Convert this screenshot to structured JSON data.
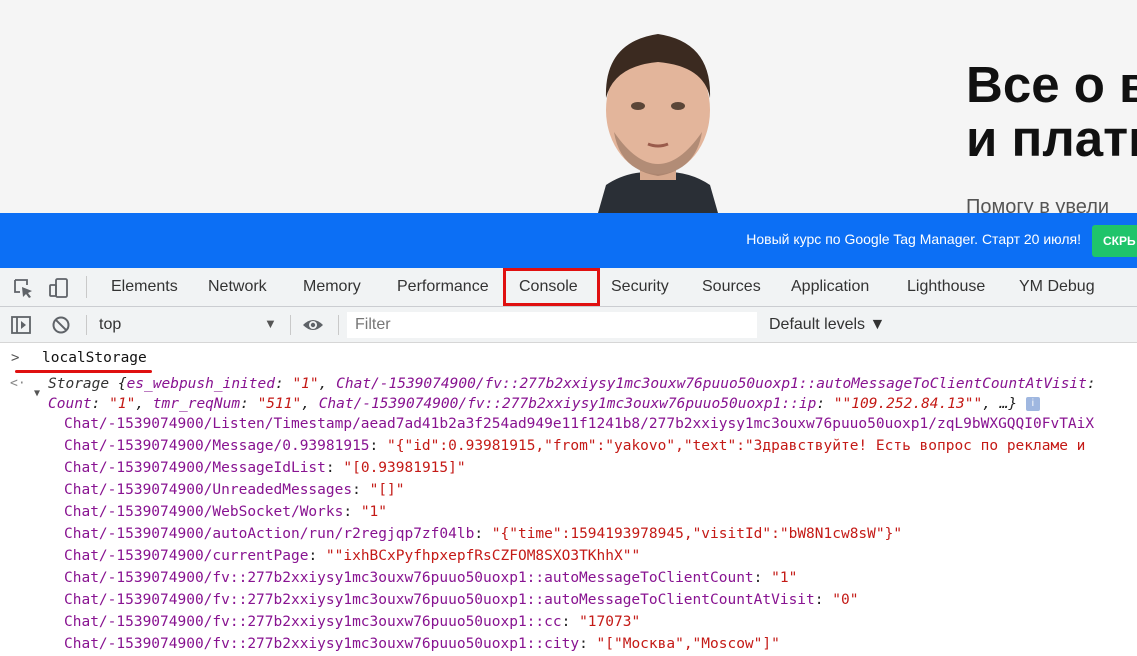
{
  "site": {
    "headline_line1": "Все о в",
    "headline_line2": "и платн",
    "subline": "Помогу в увели"
  },
  "promo": {
    "text": "Новый курс по Google Tag Manager. Старт 20 июля!",
    "button": "СКРЬ"
  },
  "devtools": {
    "tabs": [
      "Elements",
      "Network",
      "Memory",
      "Performance",
      "Console",
      "Security",
      "Sources",
      "Application",
      "Lighthouse",
      "YM Debug"
    ],
    "active_tab": "Console",
    "context": "top",
    "filter_placeholder": "Filter",
    "levels": "Default levels ▼"
  },
  "console": {
    "input": "localStorage",
    "summary_line1": {
      "type": "Storage",
      "parts": [
        {
          "k": "es_webpush_inited",
          "v": "\"1\""
        },
        {
          "k": "Chat/-1539074900/fv::277b2xxiysy1mc3ouxw76puuo50uoxp1::autoMessageToClientCountAtVisit",
          "v": ""
        }
      ]
    },
    "summary_line2": {
      "start": "Count",
      "count_val": "\"1\"",
      "tmr_key": "tmr_reqNum",
      "tmr_val": "\"511\"",
      "ip_key": "Chat/-1539074900/fv::277b2xxiysy1mc3ouxw76puuo50uoxp1::ip",
      "ip_val": "\"\"109.252.84.13\"\"",
      "tail": ", …}"
    },
    "entries": [
      {
        "key": "Chat/-1539074900/Listen/Timestamp/aead7ad41b2a3f254ad949e11f1241b8/277b2xxiysy1mc3ouxw76puuo50uoxp1/zqL9bWXGQQI0FvTAiX",
        "value": ""
      },
      {
        "key": "Chat/-1539074900/Message/0.93981915",
        "value": "\"{\"id\":0.93981915,\"from\":\"yakovo\",\"text\":\"Здравствуйте! Есть вопрос по рекламе и"
      },
      {
        "key": "Chat/-1539074900/MessageIdList",
        "value": "\"[0.93981915]\""
      },
      {
        "key": "Chat/-1539074900/UnreadedMessages",
        "value": "\"[]\""
      },
      {
        "key": "Chat/-1539074900/WebSocket/Works",
        "value": "\"1\""
      },
      {
        "key": "Chat/-1539074900/autoAction/run/r2regjqp7zf04lb",
        "value": "\"{\"time\":1594193978945,\"visitId\":\"bW8N1cw8sW\"}\""
      },
      {
        "key": "Chat/-1539074900/currentPage",
        "value": "\"\"ixhBCxPyfhpxepfRsCZFOM8SXO3TKhhX\"\""
      },
      {
        "key": "Chat/-1539074900/fv::277b2xxiysy1mc3ouxw76puuo50uoxp1::autoMessageToClientCount",
        "value": "\"1\""
      },
      {
        "key": "Chat/-1539074900/fv::277b2xxiysy1mc3ouxw76puuo50uoxp1::autoMessageToClientCountAtVisit",
        "value": "\"0\""
      },
      {
        "key": "Chat/-1539074900/fv::277b2xxiysy1mc3ouxw76puuo50uoxp1::cc",
        "value": "\"17073\""
      },
      {
        "key": "Chat/-1539074900/fv::277b2xxiysy1mc3ouxw76puuo50uoxp1::city",
        "value": "\"[\"Москва\",\"Moscow\"]\""
      }
    ]
  },
  "colors": {
    "promo_blue": "#0c6ff5",
    "highlight_red": "#e01010",
    "key_purple": "#881391",
    "string_red": "#c41a16"
  },
  "icons": [
    "inspect-icon",
    "device-toggle-icon",
    "sidebar-toggle-icon",
    "clear-console-icon",
    "eye-icon",
    "info-icon"
  ]
}
